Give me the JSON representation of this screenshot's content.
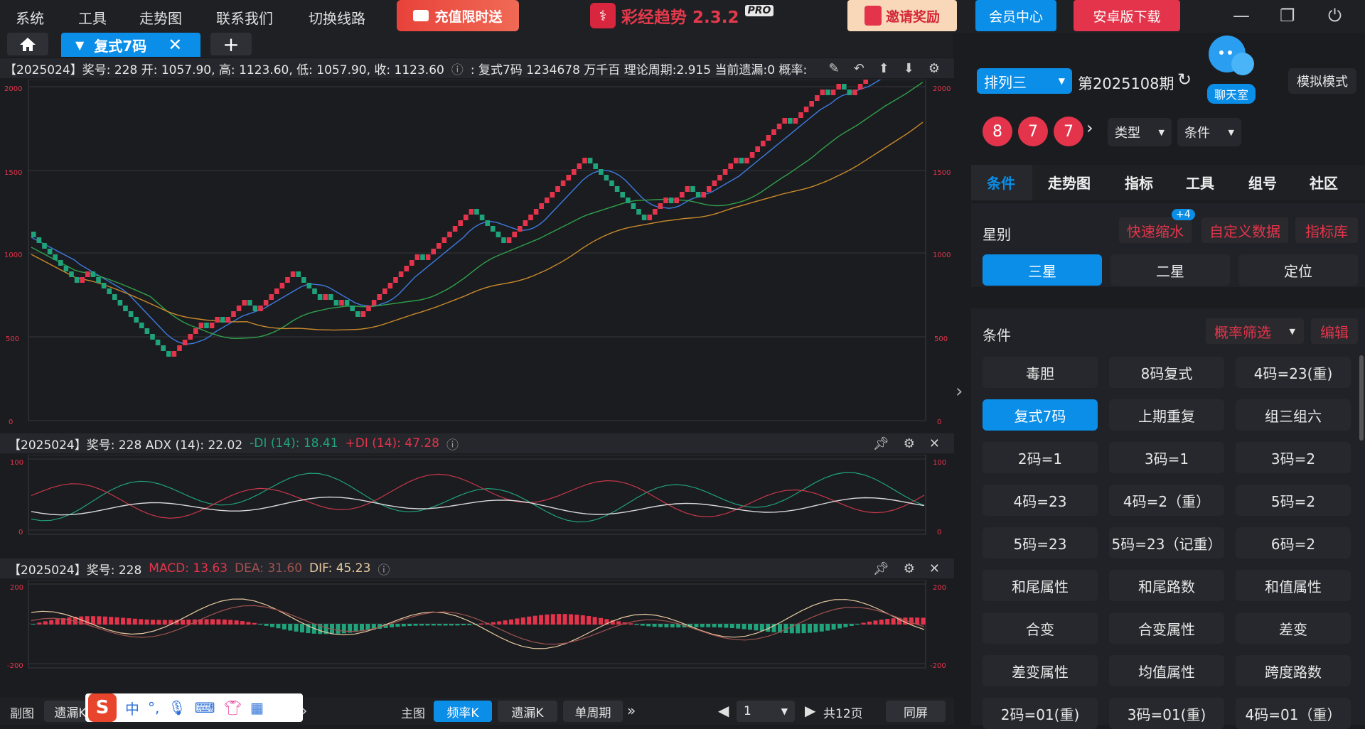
{
  "menu": [
    "系统",
    "工具",
    "走势图",
    "联系我们",
    "切换线路"
  ],
  "promo_label": "充值限时送",
  "brand": {
    "name": "彩经趋势 2.3.2",
    "badge": "PRO"
  },
  "invite_label": "邀请奖励",
  "member_label": "会员中心",
  "android_label": "安卓版下载",
  "tabs": {
    "active_label": "复式7码"
  },
  "main_header": {
    "info": "【2025024】奖号: 228  开: 1057.90, 高: 1123.60, 低: 1057.90, 收: 1123.60",
    "extra": ": 复式7码  1234678  万千百  理论周期:2.915  当前遗漏:0  概率:"
  },
  "adx_header": {
    "prefix": "【2025024】奖号: 228  ADX (14): 22.02",
    "minus_di": "-DI (14): 18.41",
    "plus_di": "+DI (14): 47.28"
  },
  "macd_header": {
    "prefix": "【2025024】奖号: 228",
    "macd": "MACD: 13.63",
    "dea": "DEA: 31.60",
    "dif": "DIF: 45.23"
  },
  "axis": {
    "main": [
      "2000",
      "1500",
      "1000",
      "500",
      "0"
    ],
    "adx": [
      "100",
      "0"
    ],
    "macd": [
      "200",
      "-200"
    ]
  },
  "bottom": {
    "sub_label": "副图",
    "sub_btn": "遗漏K",
    "main_label": "主图",
    "freq_btn": "频率K",
    "miss_btn": "遗漏K",
    "single_btn": "单周期",
    "page_value": "1",
    "total_pages": "共12页",
    "sync_btn": "同屏"
  },
  "ime": {
    "logo": "S",
    "lang": "中",
    "punct": "°,"
  },
  "right": {
    "lottery": "排列三",
    "period": "第2025108期",
    "mode": "模拟模式",
    "chat": "聊天室",
    "balls": [
      "8",
      "7",
      "7"
    ],
    "type_label": "类型",
    "cond_label": "条件",
    "nav": [
      "条件",
      "走势图",
      "指标",
      "工具",
      "组号",
      "社区"
    ],
    "star_label": "星别",
    "badge": "+4",
    "quick_shrink": "快速缩水",
    "custom_data": "自定义数据",
    "indicator_lib": "指标库",
    "stars": [
      "三星",
      "二星",
      "定位"
    ],
    "conditions_label": "条件",
    "prob_filter": "概率筛选",
    "edit_label": "编辑",
    "conditions": [
      "毒胆",
      "8码复式",
      "4码=23(重)",
      "复式7码",
      "上期重复",
      "组三组六",
      "2码=1",
      "3码=1",
      "3码=2",
      "4码=23",
      "4码=2（重）",
      "5码=2",
      "5码=23",
      "5码=23（记重）",
      "6码=2",
      "和尾属性",
      "和尾路数",
      "和值属性",
      "合变",
      "合变属性",
      "差变",
      "差变属性",
      "均值属性",
      "跨度路数",
      "2码=01(重)",
      "3码=01(重)",
      "4码=01（重）"
    ]
  },
  "colors": {
    "accent": "#0a8ee8",
    "red": "#e4344b",
    "green": "#1fa37a"
  }
}
